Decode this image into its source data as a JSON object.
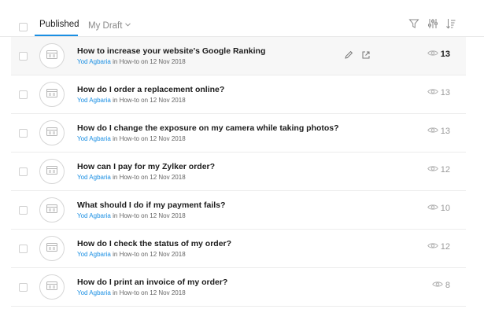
{
  "tabs": {
    "published_label": "Published",
    "draft_label": "My Draft"
  },
  "toolbar": {
    "icons": [
      "filter-icon",
      "sliders-icon",
      "sort-icon"
    ]
  },
  "articles": [
    {
      "title": "How to increase your website's Google Ranking",
      "author": "Yod Agbaria",
      "in_label": "in",
      "category": "How-to",
      "on_label": "on",
      "date": "12 Nov 2018",
      "views": "13"
    },
    {
      "title": "How do I order a replacement online?",
      "author": "Yod Agbaria",
      "in_label": "in",
      "category": "How-to",
      "on_label": "on",
      "date": "12 Nov 2018",
      "views": "13"
    },
    {
      "title": "How do I change the exposure on my camera while taking photos?",
      "author": "Yod Agbaria",
      "in_label": "in",
      "category": "How-to",
      "on_label": "on",
      "date": "12 Nov 2018",
      "views": "13"
    },
    {
      "title": "How can I pay for my Zylker order?",
      "author": "Yod Agbaria",
      "in_label": "in",
      "category": "How-to",
      "on_label": "on",
      "date": "12 Nov 2018",
      "views": "12"
    },
    {
      "title": "What should I do if my payment fails?",
      "author": "Yod Agbaria",
      "in_label": "in",
      "category": "How-to",
      "on_label": "on",
      "date": "12 Nov 2018",
      "views": "10"
    },
    {
      "title": "How do I check the status of my order?",
      "author": "Yod Agbaria",
      "in_label": "in",
      "category": "How-to",
      "on_label": "on",
      "date": "12 Nov 2018",
      "views": "12"
    },
    {
      "title": "How do I print an invoice of my order?",
      "author": "Yod Agbaria",
      "in_label": "in",
      "category": "How-to",
      "on_label": "on",
      "date": "12 Nov 2018",
      "views": "8"
    }
  ],
  "colors": {
    "accent": "#1a8fe3",
    "hover_row": "#f7f7f7"
  }
}
